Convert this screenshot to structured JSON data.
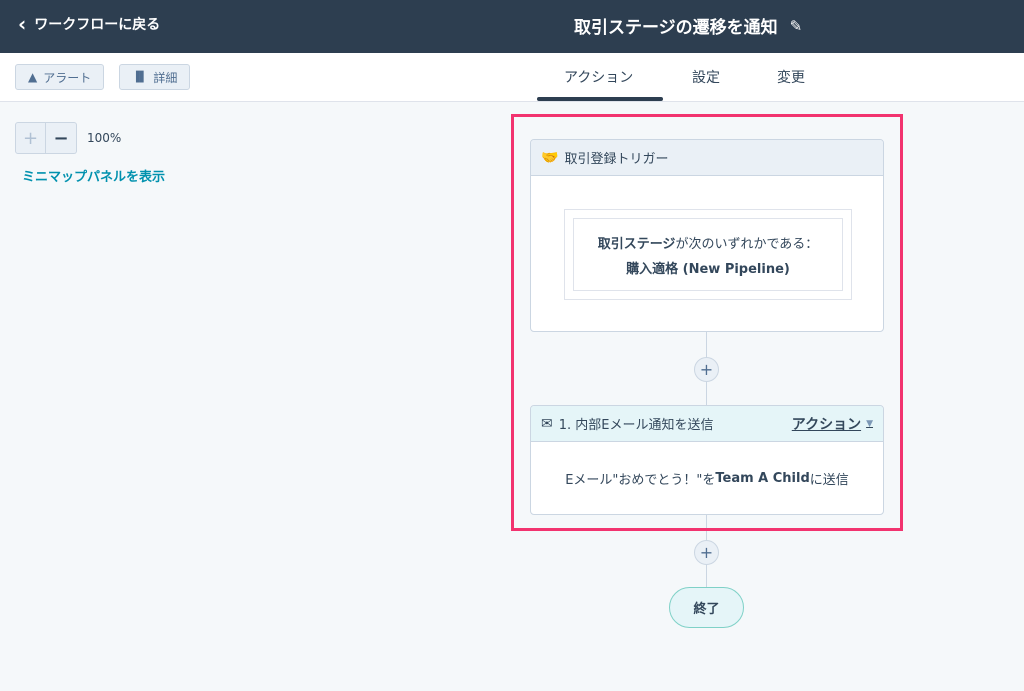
{
  "topbar": {
    "back_label": "ワークフローに戻る",
    "title": "取引ステージの遷移を通知"
  },
  "toolbar": {
    "alert_label": "アラート",
    "details_label": "詳細"
  },
  "tabs": [
    {
      "label": "アクション"
    },
    {
      "label": "設定"
    },
    {
      "label": "変更"
    }
  ],
  "zoom": {
    "plus": "+",
    "minus": "−",
    "value": "100%"
  },
  "minimap_link": "ミニマップパネルを表示",
  "trigger": {
    "title": "取引登録トリガー",
    "condition_bold": "取引ステージ",
    "condition_rest": "が次のいずれかである：",
    "condition_value": "購入適格 (New Pipeline)"
  },
  "action": {
    "title": "1. 内部Eメール通知を送信",
    "menu_label": "アクション",
    "body_prefix": "Eメール\"おめでとう！\"を",
    "body_bold": "Team A Child",
    "body_suffix": "に送信"
  },
  "add_symbol": "+",
  "end_label": "終了"
}
